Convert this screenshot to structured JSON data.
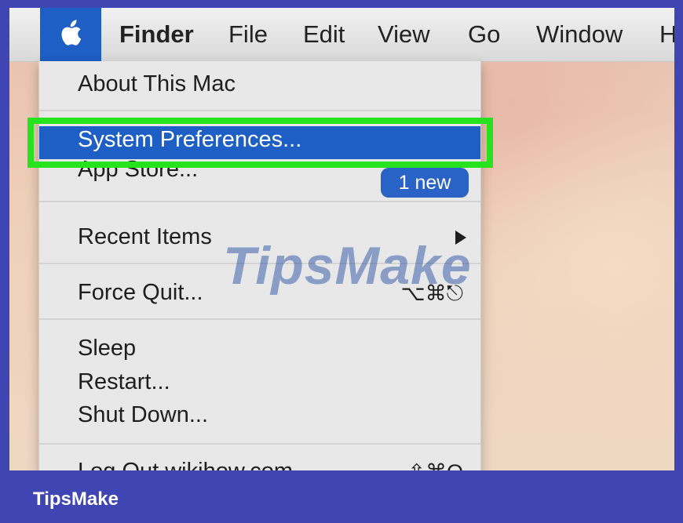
{
  "menubar": {
    "app_name": "Finder",
    "menus": [
      "File",
      "Edit",
      "View",
      "Go",
      "Window",
      "H"
    ]
  },
  "apple_menu": {
    "items": {
      "about": "About This Mac",
      "system_preferences": "System Preferences...",
      "app_store": "App Store...",
      "app_store_badge": "1 new",
      "recent_items": "Recent Items",
      "force_quit": "Force Quit...",
      "force_quit_shortcut": "⌥⌘⎋",
      "sleep": "Sleep",
      "restart": "Restart...",
      "shut_down": "Shut Down...",
      "log_out": "Log Out wikihow.com...",
      "log_out_shortcut": "⇧⌘Q"
    },
    "submenu_arrow_icon": "triangle-right-icon"
  },
  "watermark": "TipsMake",
  "footer": {
    "brand": "TipsMake"
  },
  "colors": {
    "highlight": "#1d5fc5",
    "annotation_box": "#27e21f",
    "frame": "#3f45b3"
  }
}
